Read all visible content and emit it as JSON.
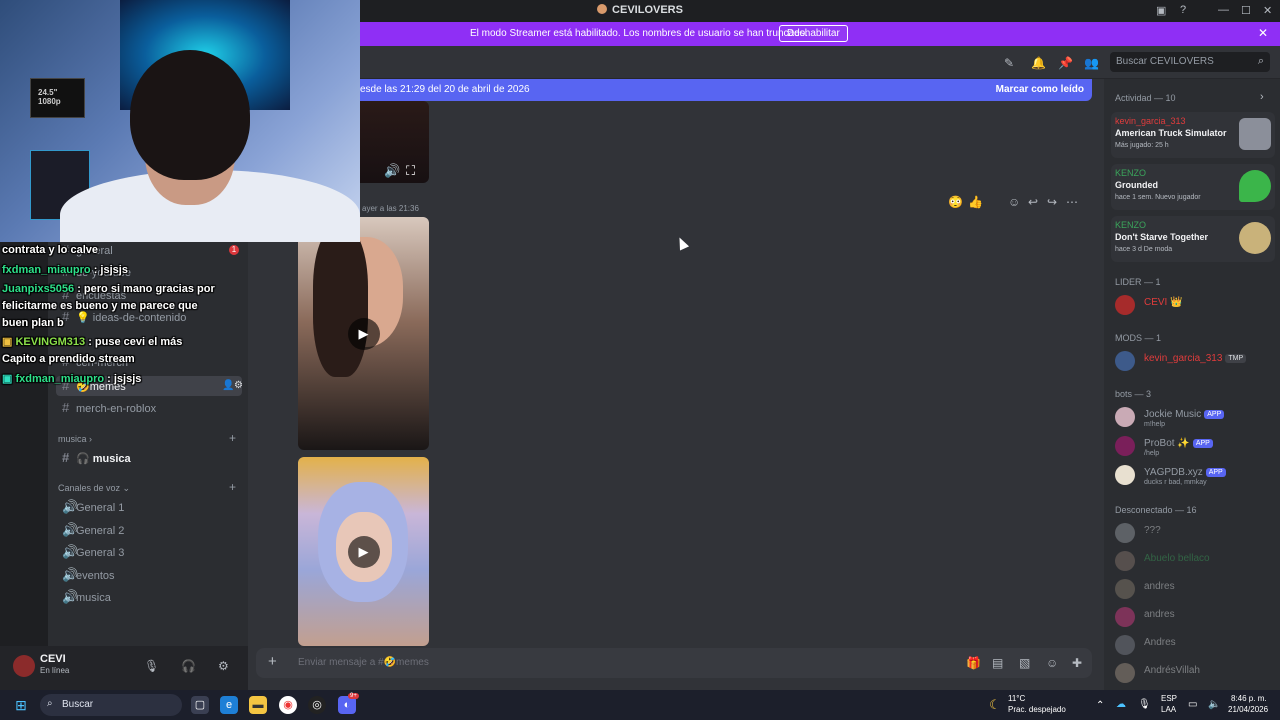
{
  "window": {
    "title": "CEVILOVERS"
  },
  "banner": {
    "text": "El modo Streamer está habilitado. Los nombres de usuario se han truncado.",
    "button": "Deshabilitar"
  },
  "header": {
    "search_placeholder": "Buscar CEVILOVERS"
  },
  "new_messages": {
    "text": "esde las 21:29 del 20 de abril de 2026",
    "mark_read": "Marcar como leído"
  },
  "messages": {
    "timestamp": "ayer a las 21:36"
  },
  "composer": {
    "placeholder": "Enviar mensaje a #🤣memes"
  },
  "channels": {
    "items": [
      {
        "label": "general"
      },
      {
        "label": "de-youtube"
      },
      {
        "label": "encuestas"
      },
      {
        "label": "💡 ideas-de-contenido"
      },
      {
        "label": "ceri-merch"
      },
      {
        "label": "🤣memes"
      },
      {
        "label": "merch-en-roblox"
      }
    ],
    "cat_musica": "musica",
    "musica_channel": "🎧 musica",
    "cat_voice": "Canales de voz",
    "voice": [
      "General 1",
      "General 2",
      "General 3",
      "eventos",
      "musica"
    ],
    "badge": "1"
  },
  "user": {
    "name": "CEVI",
    "status": "En línea"
  },
  "chat_overlay": [
    {
      "user": "",
      "text": "contrata y lo calve"
    },
    {
      "user": "fxdman_miaupro",
      "text": " : jsjsjs"
    },
    {
      "user": "Juanpixs5056",
      "text": " : pero si mano gracias por"
    },
    {
      "user": "",
      "text": "felicitarme es bueno y me parece que"
    },
    {
      "user": "",
      "text": "buen plan b"
    },
    {
      "user": "KEVINGM313",
      "text": " : puse  cevi el más"
    },
    {
      "user": "",
      "text": "Capito a prendido stream"
    },
    {
      "user": "fxdman_miaupro",
      "text": " : jsjsjs"
    }
  ],
  "webcam": {
    "monitor_line1": "24.5\"",
    "monitor_line2": "1080p"
  },
  "members": {
    "activity_header": "Actividad — 10",
    "activities": [
      {
        "name": "kevin_garcia_313",
        "game": "American Truck Simulator",
        "status": "Más jugado: 25 h",
        "color": "#e03c3c"
      },
      {
        "name": "KENZO",
        "game": "Grounded",
        "status": "hace 1 sem.   Nuevo jugador",
        "color": "#3ba55c"
      },
      {
        "name": "KENZO",
        "game": "Don't Starve Together",
        "status": "hace 3 d   De moda",
        "color": "#3ba55c"
      }
    ],
    "lider_header": "LIDER — 1",
    "lider": {
      "name": "CEVI 👑"
    },
    "mods_header": "MODS — 1",
    "mod": {
      "name": "kevin_garcia_313",
      "tag": "TMP"
    },
    "bots_header": "bots — 3",
    "bots": [
      {
        "name": "Jockie Music",
        "tag": "APP",
        "sub": "m!help"
      },
      {
        "name": "ProBot ✨",
        "tag": "APP",
        "sub": "/help"
      },
      {
        "name": "YAGPDB.xyz",
        "tag": "APP",
        "sub": "ducks r bad, mmkay"
      }
    ],
    "offline_header": "Desconectado — 16",
    "offline": [
      "???",
      "Abuelo bellaco",
      "andres",
      "andres",
      "Andres",
      "AndrésVillah"
    ]
  },
  "taskbar": {
    "search": "Buscar",
    "weather_temp": "11°C",
    "weather_desc": "Prac. despejado",
    "lang1": "ESP",
    "lang2": "LAA",
    "time": "8:46 p. m.",
    "date": "21/04/2026",
    "discord_badge": "9+"
  }
}
